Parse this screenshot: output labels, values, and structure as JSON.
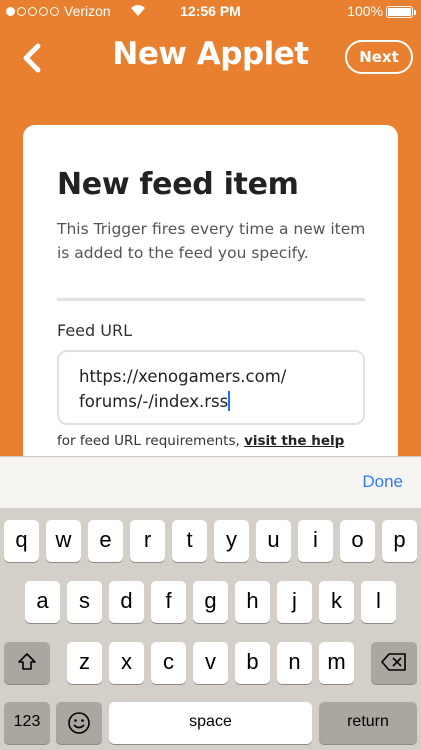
{
  "status_bar": {
    "carrier": "Verizon",
    "time": "12:56 PM",
    "battery": "100%"
  },
  "nav": {
    "title": "New Applet",
    "next_label": "Next",
    "back_icon": "chevron-left-icon"
  },
  "card": {
    "title": "New feed item",
    "description": "This Trigger fires every time a new item is added to the feed you specify.",
    "field_label": "Feed URL",
    "url_line1": "https://xenogamers.com/",
    "url_line2": "forums/-/index.rss",
    "help_prefix": "for feed URL requirements, ",
    "help_link": "visit the help"
  },
  "accessory": {
    "done_label": "Done"
  },
  "keyboard": {
    "row1": [
      "q",
      "w",
      "e",
      "r",
      "t",
      "y",
      "u",
      "i",
      "o",
      "p"
    ],
    "row2": [
      "a",
      "s",
      "d",
      "f",
      "g",
      "h",
      "j",
      "k",
      "l"
    ],
    "row3": [
      "z",
      "x",
      "c",
      "v",
      "b",
      "n",
      "m"
    ],
    "numbers_label": "123",
    "space_label": "space",
    "return_label": "return",
    "shift_icon": "shift-icon",
    "delete_icon": "delete-icon",
    "emoji_icon": "emoji-icon"
  },
  "colors": {
    "brand_orange": "#e8802f",
    "done_blue": "#2f7cf6",
    "keyboard_bg": "#d5cfc9"
  }
}
